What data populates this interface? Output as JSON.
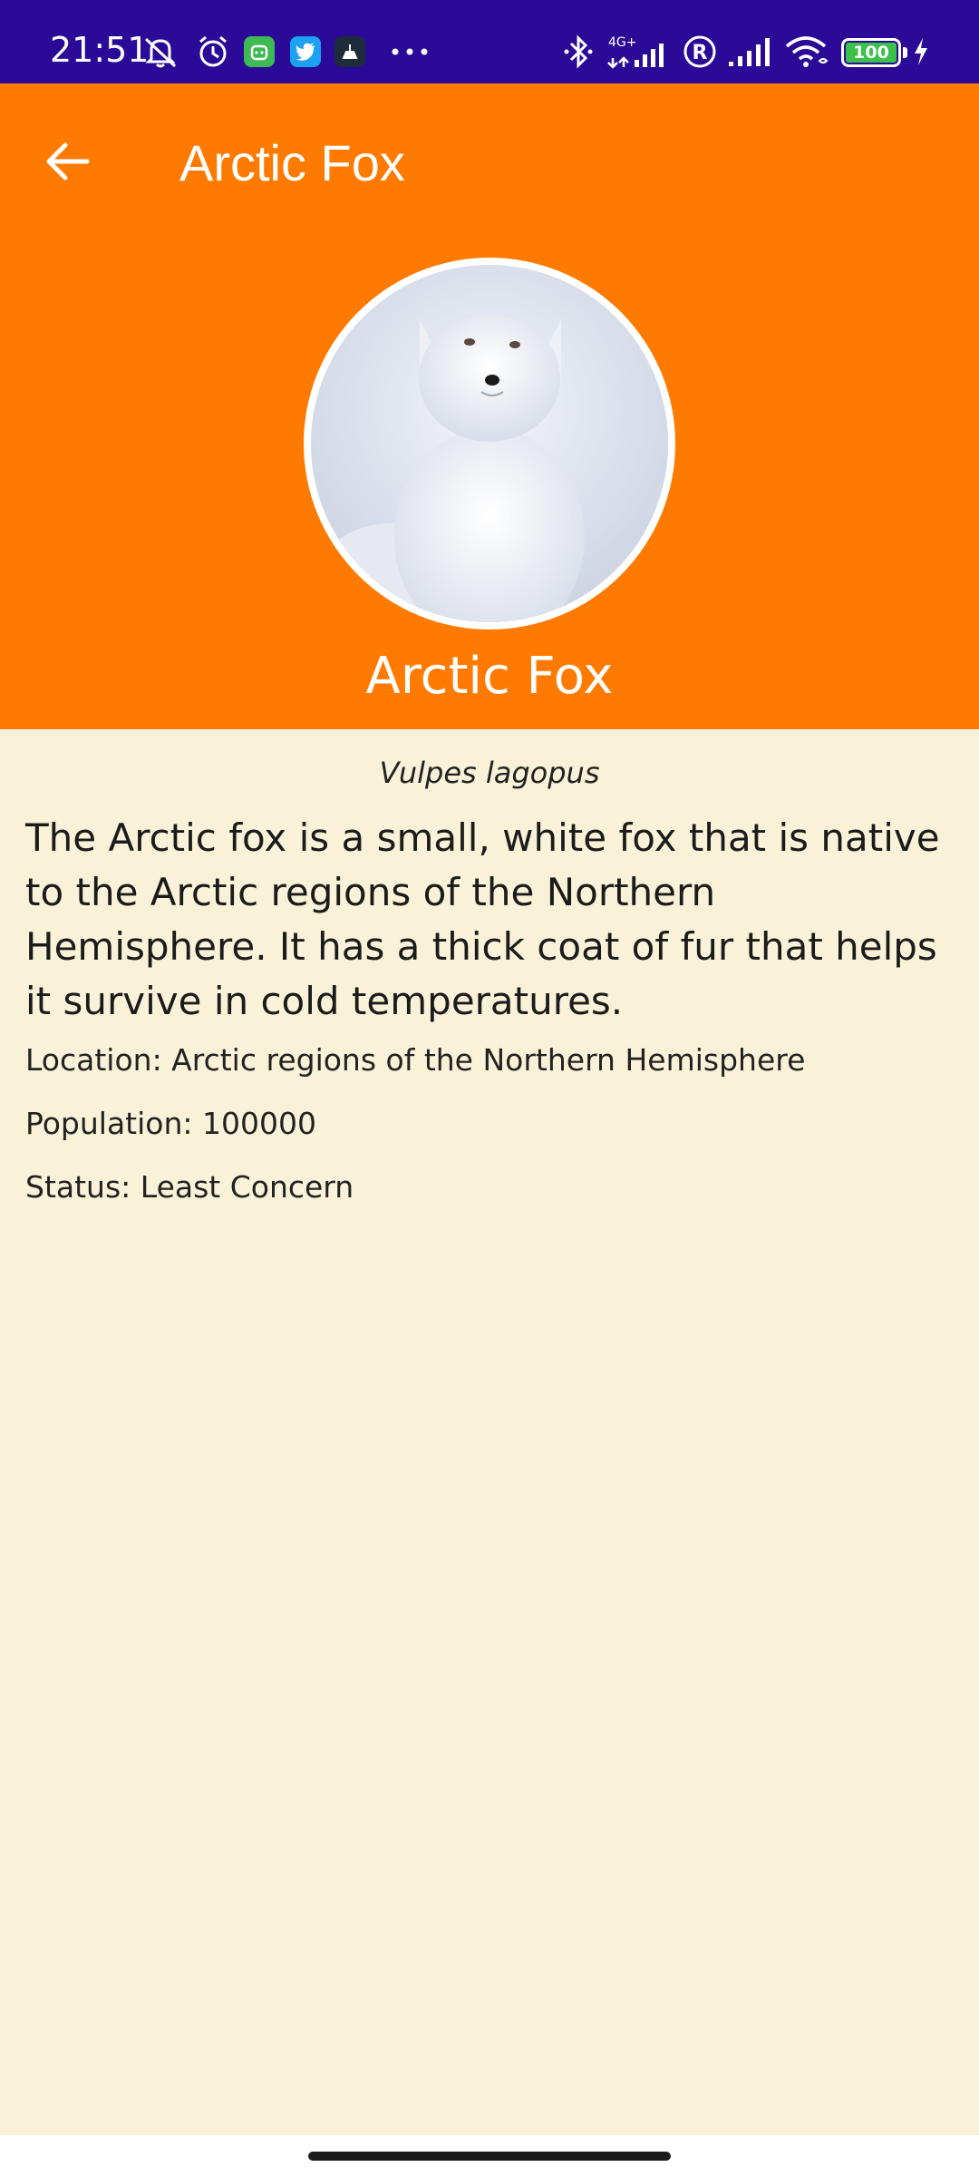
{
  "status_bar": {
    "time": "21:51",
    "network_label": "4G+",
    "battery_level": "100",
    "colors": {
      "background": "#2A0A96"
    },
    "icons": [
      "mute-icon",
      "alarm-icon",
      "app-notification-icon",
      "twitter-icon",
      "app-icon",
      "more-icon",
      "bluetooth-icon",
      "signal-4g-icon",
      "roaming-icon",
      "signal-icon",
      "wifi-icon",
      "battery-icon",
      "charging-icon"
    ]
  },
  "app_bar": {
    "title": "Arctic Fox",
    "back_icon": "arrow-back-icon"
  },
  "profile": {
    "name": "Arctic Fox",
    "image_alt": "arctic-fox-photo"
  },
  "details": {
    "scientific_name": "Vulpes lagopus",
    "description": "The Arctic fox is a small, white fox that is native to the Arctic regions of the Northern Hemisphere. It has a thick coat of fur that helps it survive in cold temperatures.",
    "location": "Location: Arctic regions of the Northern Hemisphere",
    "population": "Population: 100000",
    "status": "Status: Least Concern"
  },
  "theme": {
    "header_color": "#FF7A00",
    "background_color": "#FAF2D8"
  }
}
